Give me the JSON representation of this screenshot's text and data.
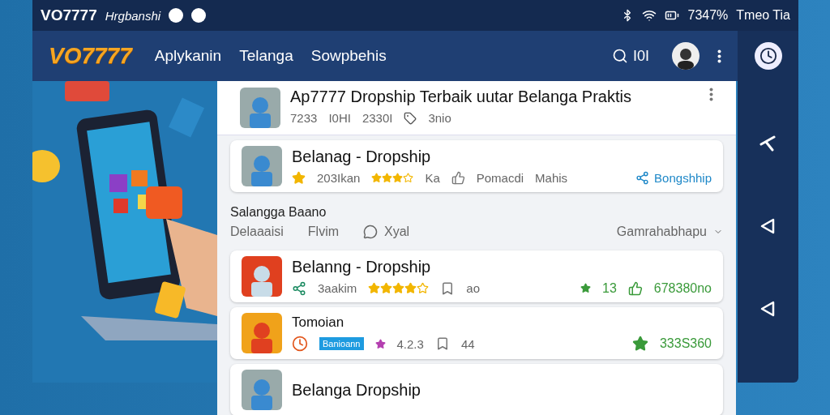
{
  "status_bar": {
    "title": "VO7777",
    "subtitle": "Hrgbanshi",
    "battery": "7347%",
    "right_text": "Tmeo Tia"
  },
  "nav": {
    "logo": "VO7777",
    "links": [
      "Aplykanin",
      "Telanga",
      "Sowpbehis"
    ],
    "search": "I0I"
  },
  "featured": {
    "title": "Ap7777 Dropship Terbaik uutar Belanga Praktis",
    "meta": [
      "7233",
      "I0HI",
      "2330I"
    ],
    "tag": "3nio"
  },
  "card": {
    "title": "Belanag - Dropship",
    "rating": "203Ikan",
    "rating_short": "Ka",
    "stars": 3,
    "stats": [
      "Pomacdi",
      "Mahis"
    ],
    "action": "Bongshhip"
  },
  "section": {
    "title": "Salangga Baano",
    "filters": [
      "Delaaaisi",
      "Flvim",
      "Xyal"
    ],
    "sort": "Gamrahabhapu"
  },
  "items": [
    {
      "kind": "stars",
      "title": "Belanng - Dropship",
      "sub": "3aakim",
      "stars": 4,
      "count": "ao",
      "score": "13",
      "price": "678380no"
    },
    {
      "kind": "badge",
      "title": "Tomoian",
      "badge": "Banioann",
      "score": "4.2.3",
      "count": "44",
      "price": "333S360"
    },
    {
      "kind": "plain",
      "title": "Belanga Dropship"
    }
  ]
}
